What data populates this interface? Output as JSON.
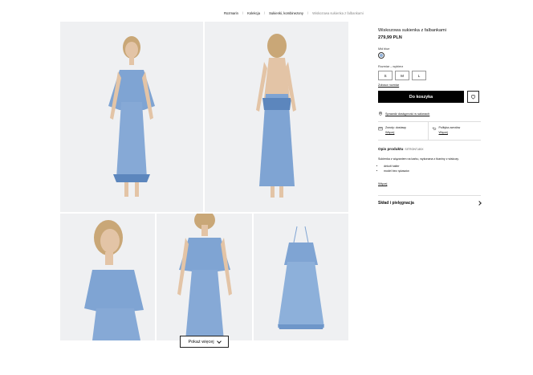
{
  "breadcrumb": [
    "Rozmarin",
    "Kolekcja",
    "Sukienki, kombinezony",
    "Wiskozowa sukienka z falbankami"
  ],
  "product": {
    "title": "Wiskozowa sukienka z falbankami",
    "price": "279,99 PLN",
    "color_label": "Mid blue",
    "color_hex": "#8fb0d8",
    "size_label": "Rozmiar – wybierz",
    "sizes": [
      "S",
      "M",
      "L"
    ],
    "size_guide": "Zobacz rozmiar",
    "add_to_cart": "Do koszyka",
    "store_link": "Sprawdź dostępność w salonach"
  },
  "policies": [
    {
      "title": "Zwroty: dostawy",
      "link": "Więcej"
    },
    {
      "title": "Polityka zwrotów",
      "link": "Więcej"
    }
  ],
  "description": {
    "heading": "Opis produktu",
    "code": "SITRONT-80X",
    "text": "Sukienka z wiązaniem na karku, wykonana z tkaniny z wiskozy.",
    "bullets": [
      "dekolt halter",
      "model bez rękawów"
    ],
    "more": "Więcej"
  },
  "care": {
    "label": "Skład i pielęgnacja"
  },
  "gallery": {
    "show_more": "Pokaż więcej"
  },
  "colors": {
    "dress": "#7fa4d3",
    "dress_dark": "#5c86bd",
    "skin": "#e3c4a6",
    "hair": "#c9a777",
    "bg": "#eff0f2"
  }
}
